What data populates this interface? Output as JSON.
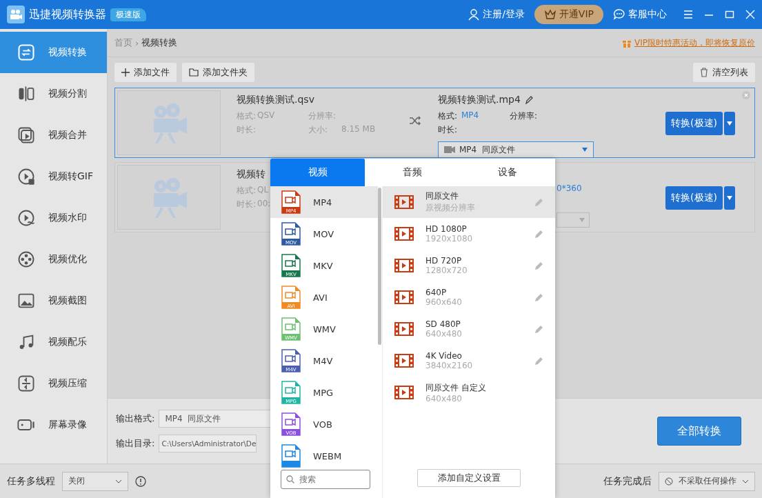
{
  "app": {
    "title": "迅捷视频转换器",
    "edition": "极速版"
  },
  "header": {
    "account": "注册/登录",
    "vip": "开通VIP",
    "support": "客服中心"
  },
  "sidebar": [
    {
      "label": "视频转换",
      "selected": true
    },
    {
      "label": "视频分割",
      "selected": false
    },
    {
      "label": "视频合并",
      "selected": false
    },
    {
      "label": "视频转GIF",
      "selected": false
    },
    {
      "label": "视频水印",
      "selected": false
    },
    {
      "label": "视频优化",
      "selected": false
    },
    {
      "label": "视频截图",
      "selected": false
    },
    {
      "label": "视频配乐",
      "selected": false
    },
    {
      "label": "视频压缩",
      "selected": false
    },
    {
      "label": "屏幕录像",
      "selected": false
    }
  ],
  "breadcrumb": [
    "首页",
    "视频转换"
  ],
  "breadcrumb_separator": "›",
  "promo": "VIP限时特惠活动，即将恢复原价",
  "toolbar": {
    "add_file": "添加文件",
    "add_folder": "添加文件夹",
    "clear": "清空列表"
  },
  "tasks": [
    {
      "selected": true,
      "source_name": "视频转换测试.qsv",
      "format_label": "格式:",
      "format": "QSV",
      "resolution_label": "分辨率:",
      "duration_label": "时长:",
      "size_label": "大小:",
      "size": "8.15 MB",
      "target_name": "视频转换测试.mp4",
      "target_format_label": "格式:",
      "target_format": "MP4",
      "target_resolution_label": "分辨率:",
      "target_duration_label": "时长:",
      "preset": "MP4  同原文件",
      "convert": "转换(极速)"
    },
    {
      "selected": false,
      "source_name": "视频转",
      "format_label": "格式:",
      "format": "QL",
      "duration_label": "时长:",
      "duration": "00:",
      "target_resolution": "0*360",
      "convert": "转换(极速)"
    }
  ],
  "popup": {
    "tabs": [
      {
        "label": "视频",
        "selected": true
      },
      {
        "label": "音频",
        "selected": false
      },
      {
        "label": "设备",
        "selected": false
      }
    ],
    "formats": [
      {
        "name": "MP4",
        "badge": "MP4",
        "color": "#cc3a12",
        "selected": true
      },
      {
        "name": "MOV",
        "badge": "MOV",
        "color": "#2d5aa0",
        "selected": false
      },
      {
        "name": "MKV",
        "badge": "MKV",
        "color": "#16784a",
        "selected": false
      },
      {
        "name": "AVI",
        "badge": "AVI",
        "color": "#f08a24",
        "selected": false
      },
      {
        "name": "WMV",
        "badge": "WMV",
        "color": "#6cc070",
        "selected": false
      },
      {
        "name": "M4V",
        "badge": "M4V",
        "color": "#4a5fb0",
        "selected": false
      },
      {
        "name": "MPG",
        "badge": "MPG",
        "color": "#1fb5a5",
        "selected": false
      },
      {
        "name": "VOB",
        "badge": "VOB",
        "color": "#8a4fe0",
        "selected": false
      },
      {
        "name": "WEBM",
        "color": "#1e88e5",
        "selected": false
      }
    ],
    "presets": [
      {
        "name": "同原文件",
        "detail": "原视频分辨率",
        "editable": true,
        "selected": true
      },
      {
        "name": "HD 1080P",
        "detail": "1920x1080",
        "editable": true,
        "selected": false
      },
      {
        "name": "HD 720P",
        "detail": "1280x720",
        "editable": true,
        "selected": false
      },
      {
        "name": "640P",
        "detail": "960x640",
        "editable": true,
        "selected": false
      },
      {
        "name": "SD 480P",
        "detail": "640x480",
        "editable": true,
        "selected": false
      },
      {
        "name": "4K Video",
        "detail": "3840x2160",
        "editable": true,
        "selected": false
      },
      {
        "name": "同原文件 自定义",
        "detail": "640x480",
        "editable": false,
        "selected": false
      }
    ],
    "search_placeholder": "搜索",
    "custom_button": "添加自定义设置"
  },
  "output": {
    "format_label": "输出格式:",
    "format": "MP4  同原文件",
    "dir_label": "输出目录:",
    "dir": "C:\\Users\\Administrator\\De",
    "convert_all": "全部转换"
  },
  "footer": {
    "threads_label": "任务多线程",
    "threads": "关闭",
    "after_label": "任务完成后",
    "after": "不采取任何操作"
  }
}
